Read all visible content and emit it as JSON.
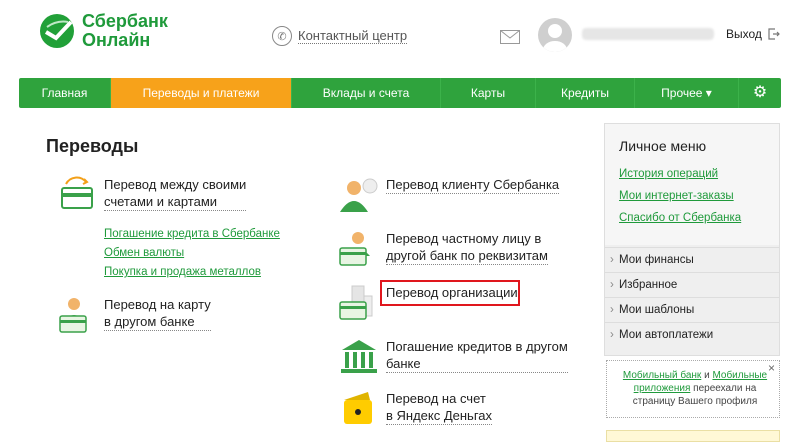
{
  "header": {
    "logo_line1": "Сбербанк",
    "logo_line2": "Онлайн",
    "contact_center": "Контактный центр",
    "logout": "Выход"
  },
  "nav": {
    "items": [
      {
        "label": "Главная"
      },
      {
        "label": "Переводы и платежи"
      },
      {
        "label": "Вклады и счета"
      },
      {
        "label": "Карты"
      },
      {
        "label": "Кредиты"
      },
      {
        "label": "Прочее ▾"
      }
    ],
    "active_index": 1
  },
  "main": {
    "title": "Переводы",
    "own_accounts": {
      "line1": "Перевод между своими",
      "line2": "счетами и картами"
    },
    "sub_links": [
      "Погашение кредита в Сбербанке",
      "Обмен валюты",
      "Покупка и продажа металлов"
    ],
    "card_other_bank": {
      "line1": "Перевод на карту",
      "line2": "в другом банке"
    },
    "sber_client": {
      "line1": "Перевод клиенту Сбербанка"
    },
    "private_person": {
      "line1": "Перевод частному лицу в",
      "line2": "другой банк по реквизитам"
    },
    "organization": {
      "line1": "Перевод организации"
    },
    "loan_other_bank": {
      "line1": "Погашение кредитов в другом",
      "line2": "банке"
    },
    "yandex": {
      "line1": "Перевод на счет",
      "line2": "в Яндекс Деньгах"
    }
  },
  "sidebar": {
    "title": "Личное меню",
    "links": [
      "История операций",
      "Мои интернет-заказы",
      "Спасибо от Сбербанка"
    ],
    "rows": [
      "Мои финансы",
      "Избранное",
      "Мои шаблоны",
      "Мои автоплатежи"
    ]
  },
  "notice": {
    "link1": "Мобильный банк",
    "and": " и ",
    "link2": "Мобильные приложения",
    "text": " переехали на страницу Вашего профиля",
    "close": "×"
  },
  "colors": {
    "brand_green": "#2fa33d",
    "accent_orange": "#f7a21a",
    "highlight_red": "#e0161d"
  }
}
